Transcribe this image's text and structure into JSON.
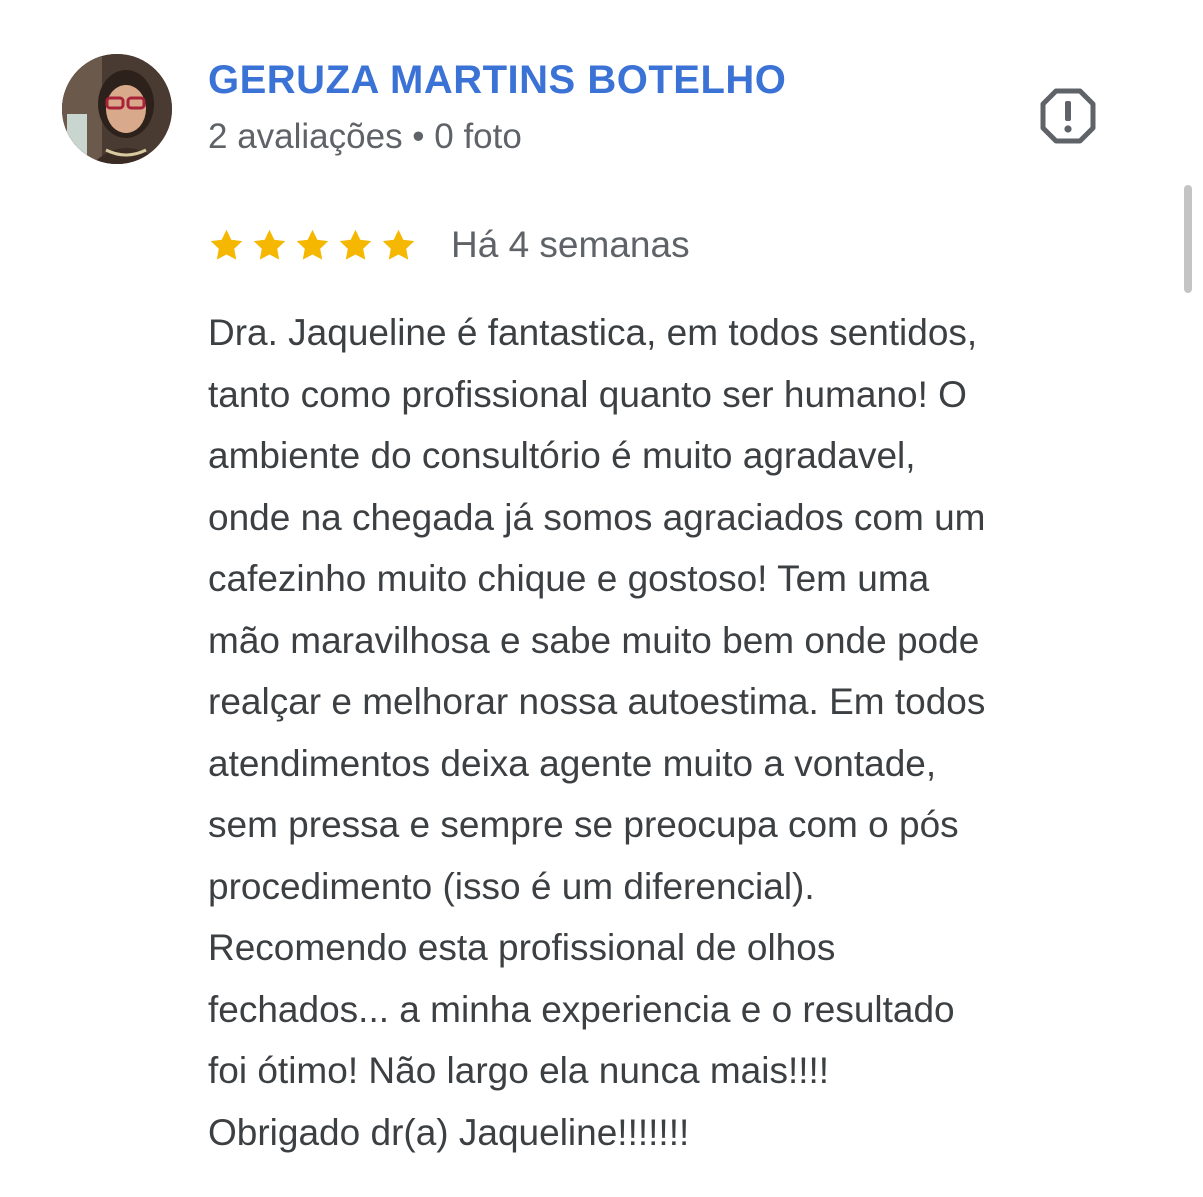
{
  "reviewer": {
    "name": "GERUZA MARTINS BOTELHO",
    "stats": "2 avaliações • 0 foto",
    "avatar": "reviewer-avatar-photo"
  },
  "report": {
    "icon": "report-flag-icon"
  },
  "review": {
    "rating": 5,
    "max_rating": 5,
    "star_color": "#f6b700",
    "date": "Há 4 semanas",
    "text": "Dra. Jaqueline é fantastica, em todos sentidos,\ntanto como profissional quanto ser humano! O\nambiente do consultório é muito agradavel,\nonde na chegada já somos agraciados com um\ncafezinho muito chique e gostoso! Tem uma\nmão maravilhosa e sabe muito bem onde pode\nrealçar e melhorar nossa autoestima. Em todos\natendimentos deixa agente muito a vontade,\nsem pressa e sempre se preocupa com o pós\nprocedimento (isso é um diferencial).\nRecomendo esta profissional de olhos\nfechados... a minha experiencia e o resultado\nfoi ótimo! Não largo ela nunca mais!!!!\nObrigado dr(a) Jaqueline!!!!!!!"
  },
  "colors": {
    "name": "#3b72d6",
    "secondary_text": "#5f6368",
    "body_text": "#3c4043"
  }
}
